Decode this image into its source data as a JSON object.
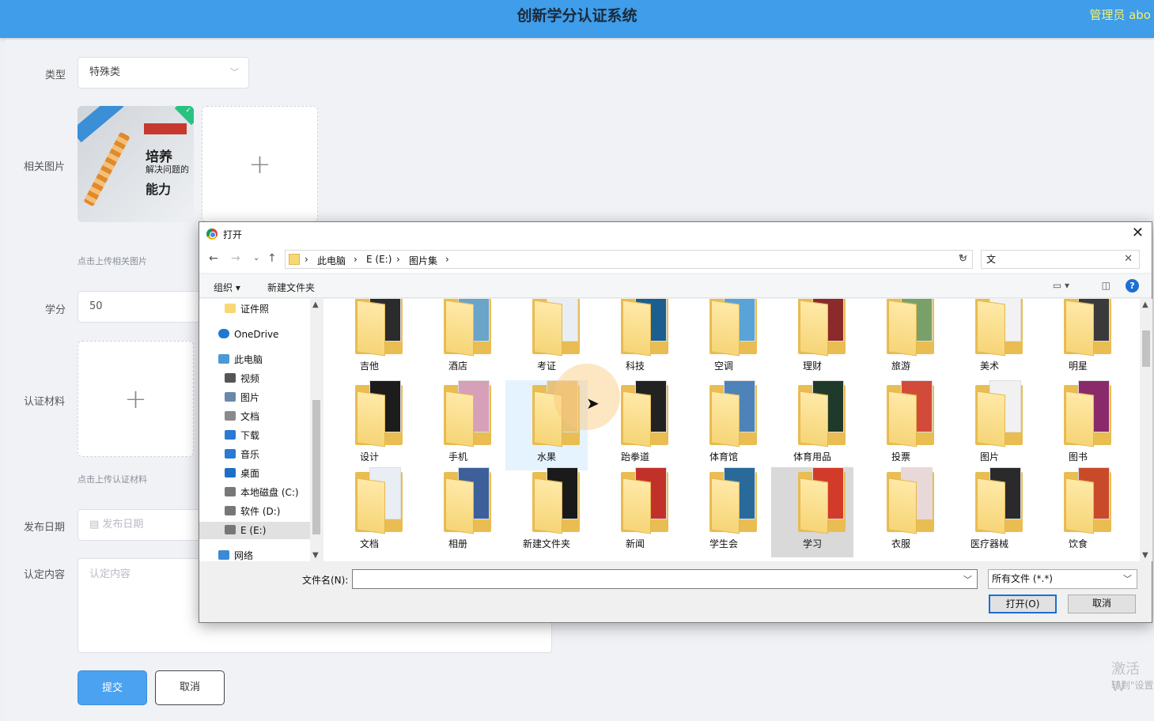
{
  "header": {
    "title": "创新学分认证系统",
    "user": "管理员 abo"
  },
  "form": {
    "type_label": "类型",
    "type_value": "特殊类",
    "image_label": "相关图片",
    "image_hint": "点击上传相关图片",
    "thumb_text": {
      "line1": "培养",
      "line2": "解决问题的",
      "line3": "能力"
    },
    "credit_label": "学分",
    "credit_value": "50",
    "material_label": "认证材料",
    "material_hint": "点击上传认证材料",
    "date_label": "发布日期",
    "date_placeholder": "发布日期",
    "content_label": "认定内容",
    "content_placeholder": "认定内容",
    "submit": "提交",
    "cancel": "取消"
  },
  "watermark": {
    "line1": "激活 W",
    "line2": "转到\"设置"
  },
  "dialog": {
    "title": "打开",
    "breadcrumbs": [
      "此电脑",
      "E (E:)",
      "图片集"
    ],
    "search_value": "文",
    "toolbar": {
      "organize": "组织 ▾",
      "new_folder": "新建文件夹"
    },
    "nav": [
      {
        "label": "证件照",
        "icon": "folder-icon",
        "color": "#f8d775"
      },
      {
        "label": "OneDrive",
        "icon": "cloud-icon",
        "color": "#1e78d4"
      },
      {
        "label": "此电脑",
        "icon": "computer-icon",
        "color": "#4a9ad8"
      },
      {
        "label": "视频",
        "icon": "video-icon",
        "color": "#555"
      },
      {
        "label": "图片",
        "icon": "picture-icon",
        "color": "#6a88a8"
      },
      {
        "label": "文档",
        "icon": "document-icon",
        "color": "#8a8a8a"
      },
      {
        "label": "下载",
        "icon": "download-icon",
        "color": "#2a7ad4"
      },
      {
        "label": "音乐",
        "icon": "music-icon",
        "color": "#2a7ad4"
      },
      {
        "label": "桌面",
        "icon": "desktop-icon",
        "color": "#1f6fc9"
      },
      {
        "label": "本地磁盘 (C:)",
        "icon": "drive-icon",
        "color": "#777"
      },
      {
        "label": "软件 (D:)",
        "icon": "drive-icon",
        "color": "#777"
      },
      {
        "label": "E (E:)",
        "icon": "drive-icon",
        "color": "#777"
      },
      {
        "label": "网络",
        "icon": "network-icon",
        "color": "#3b8ad6"
      }
    ],
    "folders": [
      {
        "name": "吉他",
        "color": "#2b2b2b"
      },
      {
        "name": "酒店",
        "color": "#6aa4c8"
      },
      {
        "name": "考证",
        "color": "#e9eef5"
      },
      {
        "name": "科技",
        "color": "#1c5e8e"
      },
      {
        "name": "空调",
        "color": "#5aa3d6"
      },
      {
        "name": "理财",
        "color": "#8a2a2a"
      },
      {
        "name": "旅游",
        "color": "#7aa06a"
      },
      {
        "name": "美术",
        "color": "#f2f2f2"
      },
      {
        "name": "明星",
        "color": "#3a3a3a"
      },
      {
        "name": "设计",
        "color": "#1c1c1c"
      },
      {
        "name": "手机",
        "color": "#d6a0b8"
      },
      {
        "name": "水果",
        "color": "#e7c27a"
      },
      {
        "name": "跆拳道",
        "color": "#222222"
      },
      {
        "name": "体育馆",
        "color": "#4d83b8"
      },
      {
        "name": "体育用品",
        "color": "#1f3a2a"
      },
      {
        "name": "投票",
        "color": "#d24a3a"
      },
      {
        "name": "图片",
        "color": "#f1f1f1"
      },
      {
        "name": "图书",
        "color": "#8a2a6a"
      },
      {
        "name": "文档",
        "color": "#e9eef5"
      },
      {
        "name": "相册",
        "color": "#3d5f9a"
      },
      {
        "name": "新建文件夹",
        "color": "#1a1a1a"
      },
      {
        "name": "新闻",
        "color": "#c2302a"
      },
      {
        "name": "学生会",
        "color": "#2a6a9a"
      },
      {
        "name": "学习",
        "color": "#d23a2a"
      },
      {
        "name": "衣服",
        "color": "#e8d8d8"
      },
      {
        "name": "医疗器械",
        "color": "#2a2a2a"
      },
      {
        "name": "饮食",
        "color": "#c84a2a"
      }
    ],
    "filename_label": "文件名(N):",
    "filename_value": "",
    "filetype_value": "所有文件 (*.*)",
    "open_button": "打开(O)",
    "cancel_button": "取消"
  }
}
